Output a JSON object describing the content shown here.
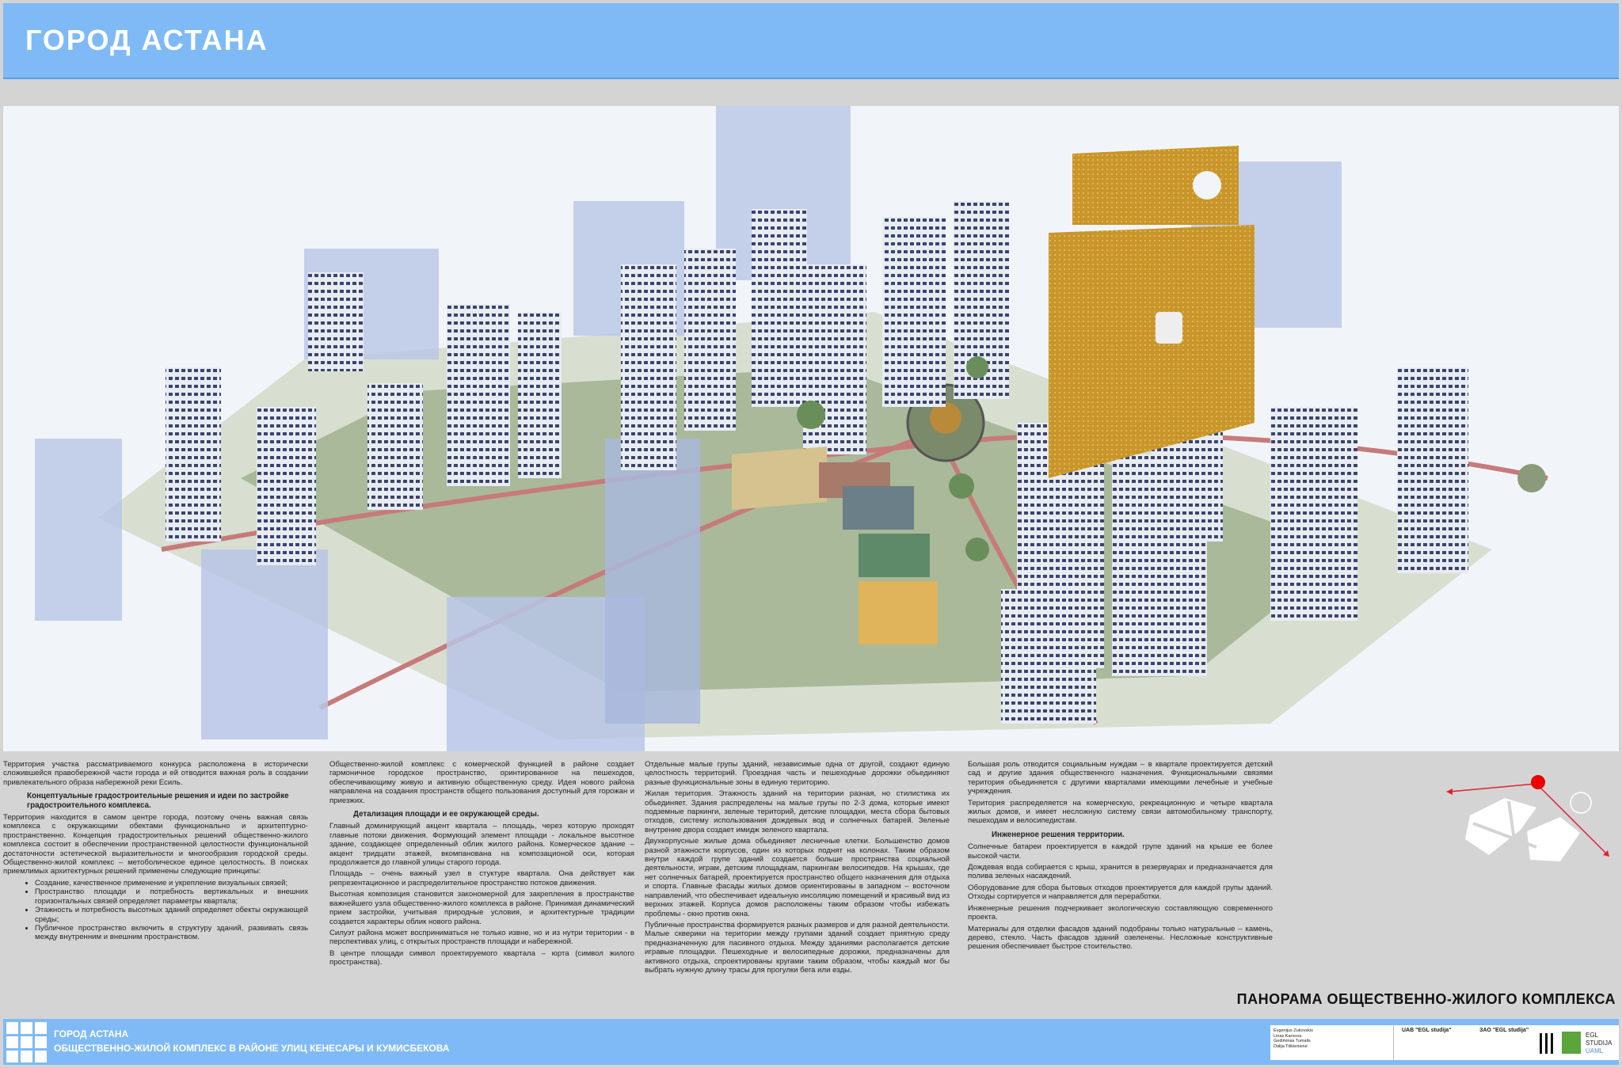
{
  "header": {
    "title": "ГОРОД АСТАНА"
  },
  "columns": {
    "c1": {
      "p1": "Территория участка рассматриваемого конкурса расположена в исторически сложившейся правобережной части города и ей отводится важная роль в создании привлекательного образа набережной реки Есиль.",
      "h1": "Концептуальные градостроительные решения и идеи по застройке градостроительного комплекса.",
      "p2": "Территория находится в самом центре города, поэтому очень важная связь комплекса с окружающими обектами функционально и архитептурно-пространственно. Концепция градостроительных решений общественно-жилого комплекса состоит в обеспечении пространственной целостности функциональной достаточности эстетической выразительности и многообразия городской среды. Общественно-жилой комплекс – метоболическое единое целостность. В поисках приемлимых архитектурных решений применены следующие принципы:",
      "li1": "Создание, качественное применение и укрепление визуальных связей;",
      "li2": "Пространство площади и потребность вертикальных и внешних горизонтальных связей определяет параметры квартала;",
      "li3": "Этажность и потребность высотных зданий определяет обекты окружающей среды;",
      "li4": "Публичное пространство включить в структуру зданий, развивать связь между внутренним и внешним пространством."
    },
    "c2": {
      "p1": "Общественно-жилой комплекс с комерческой функцией в районе создает гармоничное городское пространство, оринтированное на пешеходов, обеспечивающиму живую и активную общественную среду. Идея нового района направлена на создания пространств общего пользования доступный для горожан и приезжих.",
      "h1": "Детализация площади и ее окружающей среды.",
      "p2": "Главный доминирующий акцент квартала – площадь, через которую проходят главные потоки движения. Формующий элемент площади - локальное высотное здание, создающее определенный облик жилого района. Комерческое здание – акцент тридцати этажей, вкомпанована на композационой оси, которая продолжается до главной улицы старого города.",
      "p3": "Площадь – очень важный узел в стуктуре квартала. Она действует как репрезентационное и распределительное пространство потоков движения.",
      "p4": "Высотная композиция становится закономерной для закрепления в пространстве важнейшего узла общественно-жилого комплекса в районе. Принимая динамический прием застройки, учитывая природные условия, и архитектурные традиции создается характеры облик нового района.",
      "p5": "Силуэт района может восприниматься не только извне, но и из нутри територии - в перспективах улиц, с открытых пространств площади и набережной.",
      "p6": "В центре площади символ проектируемого квартала – юрта (символ жилого пространства)."
    },
    "c3": {
      "p1": "Отдельные малые групы зданий, независимые одна от другой, создают единую целостность территорий. Проездная часть и пешеходные дорожки обьединяют разные функциональные зоны в единую територию.",
      "p2": "Жилая територия. Этажность зданий на територии разная, но стилистика их обьединяет. Здания распределены на малые групы по 2-3 дома, которые имеют подземные паркинги, зеленые територий, детские площадки, места сбора бытовых отходов, систему использования дождевых вод и солнечных батарей. Зеленые внутрение двора создает имидж зеленого квартала.",
      "p3": "Двухкорпусные жилые дома обьединяет лесничные клетки. Большенство домов разной этажности корпусов, один из которых поднят на колонах. Таким образом внутри каждой групе зданий создается больше пространства социальной деятельности, играм, детским площадкам, паркингам велосипедов. На крышах, где нет солнечных батарей, проектируется пространство общего назначения для отдыха и спорта. Главные фасады жилых домов ориентированы в западном – восточном направлений, что обеспечивает идеальную инсоляцию помещений и красивый вид из верхних этажей. Корпуса домов расположены таким образом чтобы избежать проблемы - окно против окна.",
      "p4": "Публичные пространства формируется разных размеров и для разной деятельности. Малые скверики на територии между групами зданий создает приятную среду предназначенную для пасивного отдыха. Между зданиями располагается детские игравые площадки. Пешеходные и велосипедные дорожки, предназначены для активного отдыха, спроектированы кругами таким образом, чтобы каждый мог бы выбрать нужную длину трасы для прогулки бега или езды."
    },
    "c4": {
      "p1": "Большая роль отводится социальным нуждам – в квартале проектируется детский сад и другие здания общественного назначения. Функциональными связями територия обьединяется с другими кварталами имеющими лечебные и учебные учреждения.",
      "p2": "Територия распределяется на комерческую, рекреационную и четыре квартала жилых домов, и имеет несложную систему связи автомобильному транспорту, пешеходам и велосипедистам.",
      "h1": "Инженерное решения территории.",
      "p3": "Солнечные батареи проектируется в каждой групе зданий на крыше ее более высокой части.",
      "p4": "Дождевая вода собирается с крыш, хранится в резервуарах и предназначается для полива зеленых насаждений.",
      "p5": "Оборудование для сбора бытовых отходов проектируется для каждой групы зданий. Отходы сортируется и направляется для переработки.",
      "p6": "Инженерные решения подчеркивает экологическую составляющую современного проекта.",
      "p7": "Материалы для отделки фасадов зданий подобраны только натуральные – камень, дерево, стекло. Часть фасадов зданий озеленены. Несложные конструктивные решения обеспечивает быстрое стоительство."
    }
  },
  "caption": "ПАНОРАМА ОБЩЕСТВЕННО-ЖИЛОГО КОМПЛЕКСА",
  "footer": {
    "line1": "ГОРОД АСТАНА",
    "line2": "ОБЩЕСТВЕННО-ЖИЛОЙ КОМПЛЕКС В РАЙОНЕ УЛИЦ КЕНЕСАРЫ И КУМИСБЕКОВА",
    "names": [
      "Evgenijus Zukovskis",
      "Linas Karnosa",
      "Gediminas Tumalis",
      "Dalija Tiškienienė"
    ],
    "firm1": "UAB \"EGL studija\"",
    "firm2": "ЗАО \"EGL studija\"",
    "logo1": "EGL STUDIJA",
    "logo2": "UAML"
  },
  "colors": {
    "header": "#7fbaf6",
    "background": "#d4d4d4",
    "tower": "#c8962a"
  }
}
